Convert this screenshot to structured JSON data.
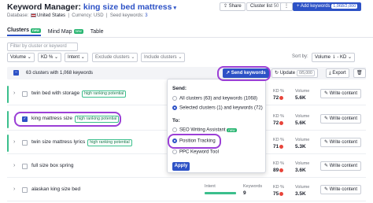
{
  "header": {
    "title_prefix": "Keyword Manager: ",
    "title_keyword": "king size bed mattress",
    "database_label": "Database:",
    "database_value": "United States",
    "currency_label": "Currency: USD",
    "seed_label": "Seed keywords:",
    "seed_value": "3",
    "share_label": "Share",
    "cluster_list_label": "Cluster list",
    "cluster_list_count": "50",
    "add_keywords_label": "Add keywords",
    "add_keywords_count": "1,068/2,000"
  },
  "tabs": [
    {
      "label": "Clusters",
      "badge": "new"
    },
    {
      "label": "Mind Map",
      "badge": "new"
    },
    {
      "label": "Table",
      "badge": ""
    }
  ],
  "filters": {
    "search_placeholder": "Filter by cluster or keyword",
    "volume": "Volume",
    "kd": "KD %",
    "intent": "Intent",
    "exclude": "Exclude clusters",
    "include": "Include clusters",
    "sort_label": "Sort by:",
    "sort_value": "Volume ⇂ - KD"
  },
  "toolbar": {
    "summary": "63 clusters with 1,068 keywords",
    "send_keywords": "Send keywords",
    "update": "Update",
    "update_count": "0/5,000",
    "export": "Export"
  },
  "rows": [
    {
      "name": "twin bed with storage",
      "badge": "high ranking potential",
      "kd": "72",
      "volume": "5.6K",
      "button": "Write content"
    },
    {
      "name": "king mattress size",
      "badge": "high ranking potential",
      "kd": "72",
      "volume": "5.6K",
      "button": "Write content"
    },
    {
      "name": "twin size mattress lyrics",
      "badge": "high ranking potential",
      "kd": "71",
      "volume": "5.3K",
      "button": "Write content"
    },
    {
      "name": "full size box spring",
      "badge": "",
      "kd": "89",
      "volume": "3.6K",
      "button": "Write content"
    },
    {
      "name": "alaskan king size bed",
      "badge": "",
      "kd": "75",
      "volume": "3.5K",
      "button": "Write content"
    }
  ],
  "last_row_extra": {
    "intent_label": "Intent",
    "keywords_label": "Keywords",
    "keywords_value": "9"
  },
  "stat_labels": {
    "kd": "KD %",
    "volume": "Volume"
  },
  "dropdown": {
    "send_heading": "Send:",
    "all_clusters": "All clusters (63) and keywords (1068)",
    "selected_clusters": "Selected clusters (1) and keywords (72)",
    "to_heading": "To:",
    "targets": [
      "SEO Writing Assistant",
      "Position Tracking",
      "PPC Keyword Tool"
    ],
    "new_badge": "new",
    "apply_label": "Apply"
  },
  "colors": {
    "accent": "#2d52c6",
    "highlight": "#9b3fd6",
    "positive": "#3bbf8c",
    "kd_hard": "#e8443a"
  }
}
